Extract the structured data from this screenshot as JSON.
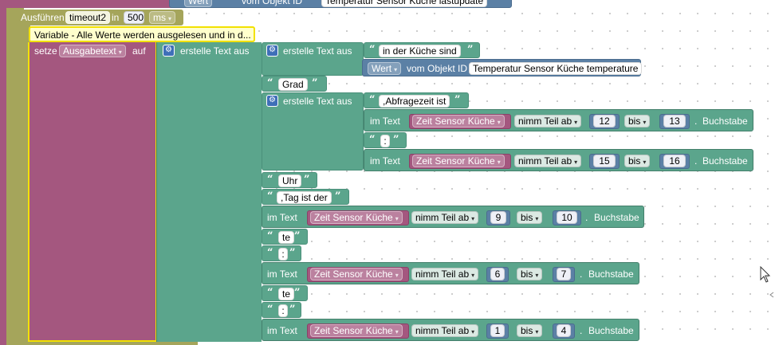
{
  "top_block": {
    "fields": [
      "Wert",
      "vom Objekt ID",
      "Temperatur Sensor Küche lastupdate"
    ]
  },
  "timeout": {
    "run_label": "Ausführen",
    "var": "timeout2",
    "in_label": "in",
    "value": "500",
    "unit": "ms"
  },
  "comment": {
    "text": "Variable - Alle Werte werden ausgelesen und in d..."
  },
  "set": {
    "label": "setze",
    "var": "Ausgabetext",
    "to_label": "auf"
  },
  "create_text": {
    "label": "erstelle Text aus"
  },
  "items": {
    "in_kueche": "in der Küche sind",
    "wert": "Wert",
    "vom_objekt": "vom Objekt ID",
    "object_id": "Temperatur Sensor Küche temperature",
    "grad": "Grad",
    "abfragezeit": ",Abfragezeit ist",
    "uhr": "Uhr",
    "tag": ",Tag ist der",
    "te1": "te",
    "colon1": ":",
    "te2": "te",
    "colon2": ":"
  },
  "substr": {
    "im_text": "im Text",
    "var": "Zeit Sensor Küche",
    "mode": "nimm Teil ab",
    "bis": "bis",
    "suffix": "Buchstabe",
    "rows": [
      {
        "from": "12",
        "to": "13"
      },
      {
        "from": "15",
        "to": "16"
      },
      {
        "from": "9",
        "to": "10"
      },
      {
        "from": "6",
        "to": "7"
      },
      {
        "from": "1",
        "to": "4"
      }
    ]
  },
  "colors": {
    "text_block": "#5ba58c",
    "variable": "#a4577f",
    "object": "#5b80a5",
    "timeout": "#a5a55b",
    "comment": "#ffffcc"
  }
}
